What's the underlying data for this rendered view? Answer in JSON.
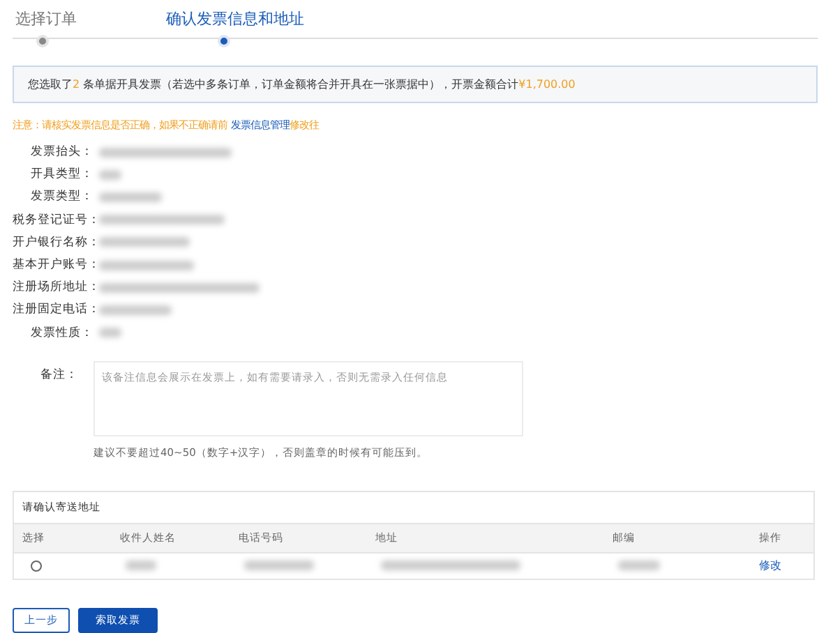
{
  "steps": [
    {
      "label": "选择订单",
      "selected": false
    },
    {
      "label": "确认发票信息和地址",
      "selected": true
    }
  ],
  "summary": {
    "prefix": "您选取了",
    "count": "2",
    "middle": " 条单据开具发票（若选中多条订单，订单金额将合并开具在一张票据中），开票金额合计",
    "amount": "¥1,700.00"
  },
  "notice": {
    "text": "注意：请核实发票信息是否正确，如果不正确请前",
    "link": "发票信息管理",
    "suffix": "修改往"
  },
  "fields": [
    {
      "label": "发票抬头："
    },
    {
      "label": "开具类型："
    },
    {
      "label": "发票类型："
    },
    {
      "label": "税务登记证号："
    },
    {
      "label": "开户银行名称："
    },
    {
      "label": "基本开户账号："
    },
    {
      "label": "注册场所地址："
    },
    {
      "label": "注册固定电话："
    },
    {
      "label": "发票性质："
    }
  ],
  "remark": {
    "label": "备注：",
    "placeholder": "该备注信息会展示在发票上，如有需要请录入，否则无需录入任何信息",
    "hint": "建议不要超过40~50（数字+汉字），否则盖章的时候有可能压到。"
  },
  "address": {
    "title": "请确认寄送地址",
    "columns": [
      "选择",
      "收件人姓名",
      "电话号码",
      "地址",
      "邮编",
      "操作"
    ],
    "rows": [
      {
        "selected": false,
        "action": "修改"
      }
    ]
  },
  "buttons": [
    {
      "label": "上一步",
      "kind": "secondary"
    },
    {
      "label": "索取发票",
      "kind": "primary"
    }
  ]
}
